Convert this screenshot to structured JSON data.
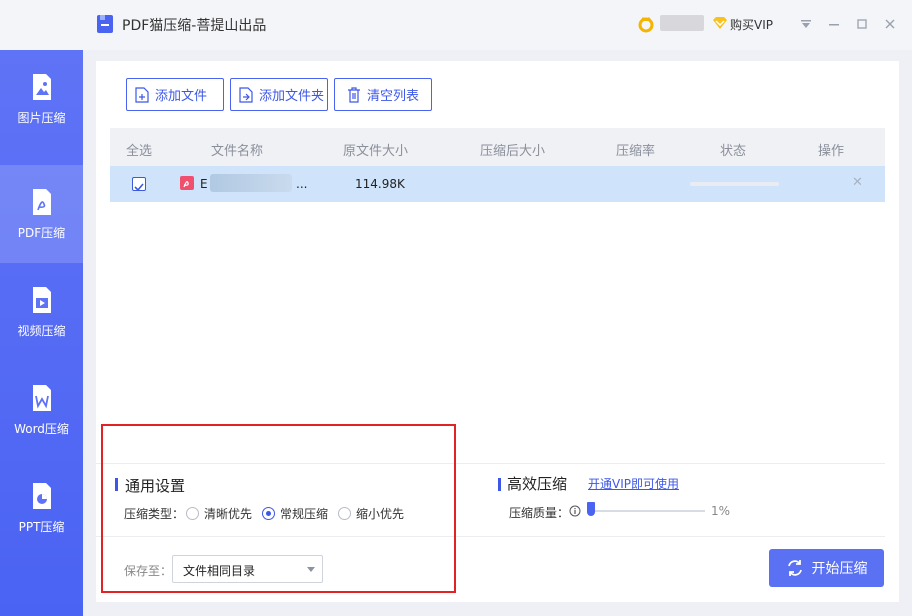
{
  "window": {
    "title": "PDF猫压缩-菩提山出品",
    "buy_vip": "购买VIP",
    "buttons": [
      "dropdown-menu",
      "minimize",
      "maximize",
      "close"
    ]
  },
  "sidebar": {
    "items": [
      {
        "label": "图片压缩",
        "icon": "image-file-icon",
        "active": false
      },
      {
        "label": "PDF压缩",
        "icon": "pdf-file-icon",
        "active": true
      },
      {
        "label": "视频压缩",
        "icon": "video-file-icon",
        "active": false
      },
      {
        "label": "Word压缩",
        "icon": "word-file-icon",
        "active": false
      },
      {
        "label": "PPT压缩",
        "icon": "ppt-file-icon",
        "active": false
      }
    ]
  },
  "toolbar": {
    "add_file": "添加文件",
    "add_folder": "添加文件夹",
    "clear_list": "清空列表"
  },
  "table": {
    "headers": [
      "全选",
      "文件名称",
      "原文件大小",
      "压缩后大小",
      "压缩率",
      "状态",
      "操作"
    ],
    "rows": [
      {
        "checked": true,
        "name_prefix": "E",
        "name_suffix": "...",
        "size": "114.98K",
        "compressed": "",
        "ratio": "",
        "status_progress": 0
      }
    ]
  },
  "general_settings": {
    "title": "通用设置",
    "type_label": "压缩类型：",
    "options": [
      "清晰优先",
      "常规压缩",
      "缩小优先"
    ],
    "selected": "常规压缩"
  },
  "efficient": {
    "title": "高效压缩",
    "vip_link": "开通VIP即可使用",
    "quality_label": "压缩质量：",
    "quality_value": "1%"
  },
  "save": {
    "label": "保存至：",
    "value": "文件相同目录"
  },
  "start_button": "开始压缩",
  "colors": {
    "accent": "#4a63f0",
    "sidebar": "#5167f4",
    "selected_row": "#cfe4fb",
    "highlight": "#e02424"
  }
}
